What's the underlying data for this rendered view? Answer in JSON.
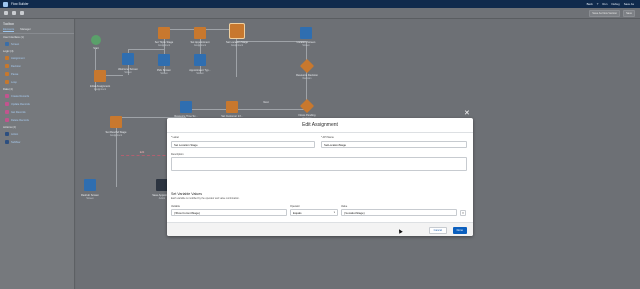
{
  "app": {
    "title": "Flow Builder",
    "top_right": [
      "Back",
      "?",
      "Run",
      "Debug",
      "Save As"
    ]
  },
  "toolbar": {
    "right_buttons": [
      "Save As New Version",
      "Save"
    ]
  },
  "left_panel": {
    "title": "Toolbox",
    "tabs": [
      "Elements",
      "Manager"
    ],
    "sections": [
      {
        "label": "User Interface (1)",
        "items": [
          {
            "label": "Screen",
            "color": "blue"
          }
        ]
      },
      {
        "label": "Logic (4)",
        "items": [
          {
            "label": "Assignment",
            "color": "orange"
          },
          {
            "label": "Decision",
            "color": "orange"
          },
          {
            "label": "Pause",
            "color": "orange"
          },
          {
            "label": "Loop",
            "color": "orange"
          }
        ]
      },
      {
        "label": "Data (4)",
        "items": [
          {
            "label": "Create Records",
            "color": "pink"
          },
          {
            "label": "Update Records",
            "color": "pink"
          },
          {
            "label": "Get Records",
            "color": "pink"
          },
          {
            "label": "Delete Records",
            "color": "pink"
          }
        ]
      },
      {
        "label": "Actions (2)",
        "items": [
          {
            "label": "Action",
            "color": "navy"
          },
          {
            "label": "Subflow",
            "color": "navy"
          }
        ]
      }
    ]
  },
  "canvas": {
    "nodes": [
      {
        "label": "Start",
        "sub": ""
      },
      {
        "label": "Initial Assignment",
        "sub": "Assignment"
      },
      {
        "label": "Welcome Screen",
        "sub": "Screen"
      },
      {
        "label": "Set Triple Stage",
        "sub": "Assignment"
      },
      {
        "label": "Pick Screen",
        "sub": "Screen"
      },
      {
        "label": "Set Appointment",
        "sub": "Assignment"
      },
      {
        "label": "Appointment Typ...",
        "sub": "Screen"
      },
      {
        "label": "Set Location Stage",
        "sub": "Assignment"
      },
      {
        "label": "Location Screen",
        "sub": "Screen"
      },
      {
        "label": "Resource Decision",
        "sub": "Decision"
      },
      {
        "label": "Resource Time Sc...",
        "sub": "Screen"
      },
      {
        "label": "Set Customer Inf...",
        "sub": "Assignment"
      },
      {
        "label": "Flows Pending",
        "sub": "Decision"
      },
      {
        "label": "Set Reschd Stage",
        "sub": "Assignment"
      },
      {
        "label": "Reshub Screen",
        "sub": "Screen"
      },
      {
        "label": "Save Appointm...",
        "sub": "Action"
      }
    ],
    "connector_labels": [
      "Edit",
      "Next"
    ]
  },
  "modal": {
    "title": "Edit Assignment",
    "close_icon": "close-icon",
    "label_field": {
      "label": "* Label",
      "value": "Set Location Stage"
    },
    "api_name_field": {
      "label": "* API Name",
      "value": "SetLocationStage"
    },
    "description_field": {
      "label": "Description",
      "value": ""
    },
    "section_title": "Set Variable Values",
    "section_desc": "Each variable is modified by the operator and value combination.",
    "row": {
      "variable_label": "Variable",
      "variable_value": "{!Flow.CurrentStage}",
      "operator_label": "Operator",
      "operator_value": "Equals",
      "value_label": "Value",
      "value_value": "{!LocationStage}"
    },
    "add_assignment": "Add Assignment",
    "cancel": "Cancel",
    "done": "Done"
  }
}
